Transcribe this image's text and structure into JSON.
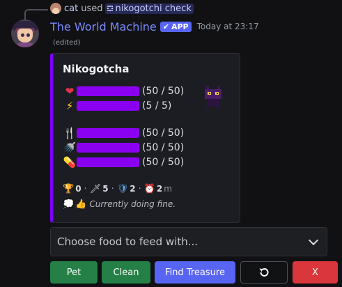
{
  "reply": {
    "user": "cat",
    "used_text": "used",
    "command": "nikogotchi check"
  },
  "message": {
    "author": "The World Machine",
    "app_tag": "APP",
    "timestamp": "Today at 23:17",
    "edited": "(edited)"
  },
  "embed": {
    "title": "Nikogotcha",
    "accent_color": "#7c00ff",
    "bar_color": "#8a00f0",
    "stats": [
      {
        "icon": "heart-icon",
        "glyph": "❤️",
        "text": "(50 / 50)",
        "fraction": 1.0
      },
      {
        "icon": "lightning-icon",
        "glyph": "⚡",
        "text": "(5 / 5)",
        "fraction": 1.0
      },
      {
        "icon": "fork-knife-icon",
        "glyph": "🍴",
        "text": "(50 / 50)",
        "fraction": 1.0
      },
      {
        "icon": "shower-icon",
        "glyph": "🫧",
        "text": "(50 / 50)",
        "fraction": 1.0
      },
      {
        "icon": "pill-icon",
        "glyph": "💊",
        "text": "(50 / 50)",
        "fraction": 1.0
      }
    ],
    "counters": [
      {
        "icon": "trophy-icon",
        "glyph": "🏆",
        "value": "0"
      },
      {
        "icon": "dagger-icon",
        "glyph": "🗡️",
        "value": "5"
      },
      {
        "icon": "shield-icon",
        "glyph": "🛡️",
        "value": "2"
      },
      {
        "icon": "alarm-clock-icon",
        "glyph": "⏰",
        "value": "2",
        "unit": "m"
      }
    ],
    "mood": {
      "icons": [
        "thought-bubble-icon",
        "thumbs-up-icon"
      ],
      "glyphs": [
        "💭",
        "👍"
      ],
      "text": "Currently doing fine."
    }
  },
  "select": {
    "placeholder": "Choose food to feed with..."
  },
  "buttons": {
    "pet": "Pet",
    "clean": "Clean",
    "find": "Find Treasure",
    "refresh_icon": "refresh-icon",
    "close": "X"
  },
  "colors": {
    "green": "#248046",
    "blurple": "#5865f2",
    "red": "#da373c",
    "link": "#7b8cff"
  }
}
